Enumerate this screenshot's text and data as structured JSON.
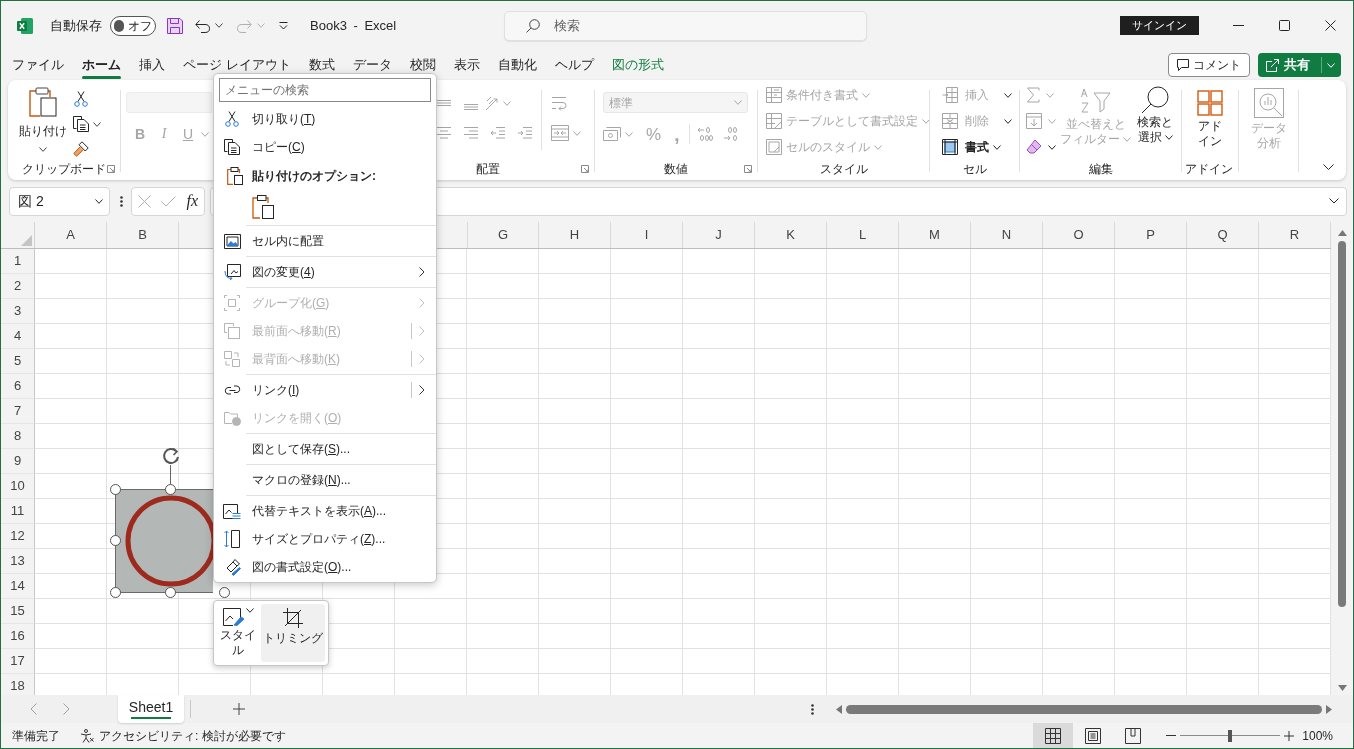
{
  "title_bar": {
    "autosave_label": "自動保存",
    "autosave_toggle": {
      "label": "オフ",
      "on": false
    },
    "redo": {
      "disabled": true
    },
    "title": "Book3 - Excel",
    "search": {
      "placeholder": "検索"
    },
    "sign_in": "サインイン"
  },
  "tabs": [
    {
      "label": "ファイル",
      "selected": false,
      "kind": "standard"
    },
    {
      "label": "ホーム",
      "selected": true,
      "kind": "standard"
    },
    {
      "label": "挿入",
      "selected": false,
      "kind": "standard"
    },
    {
      "label": "ページ レイアウト",
      "selected": false,
      "kind": "standard"
    },
    {
      "label": "数式",
      "selected": false,
      "kind": "standard"
    },
    {
      "label": "データ",
      "selected": false,
      "kind": "standard"
    },
    {
      "label": "校閲",
      "selected": false,
      "kind": "standard"
    },
    {
      "label": "表示",
      "selected": false,
      "kind": "standard"
    },
    {
      "label": "自動化",
      "selected": false,
      "kind": "standard"
    },
    {
      "label": "ヘルプ",
      "selected": false,
      "kind": "standard"
    },
    {
      "label": "図の形式",
      "selected": false,
      "kind": "contextual"
    }
  ],
  "comment_button": "コメント",
  "share_button": "共有",
  "ribbon": {
    "clipboard": {
      "label": "クリップボード",
      "paste": "貼り付け"
    },
    "font": {
      "disabled": true,
      "buttons": [
        {
          "label": "B",
          "kind": "bold"
        },
        {
          "label": "I",
          "kind": "italic"
        },
        {
          "label": "U",
          "kind": "underline"
        }
      ]
    },
    "alignment": {
      "label": "配置",
      "disabled": true
    },
    "number": {
      "label": "数値",
      "disabled": true,
      "format": "標準",
      "symbols": [
        {
          "label": "%"
        },
        {
          "label": ","
        }
      ]
    },
    "styles": {
      "label": "スタイル",
      "items": [
        {
          "label": "条件付き書式",
          "disabled": true
        },
        {
          "label": "テーブルとして書式設定",
          "disabled": true
        },
        {
          "label": "セルのスタイル",
          "disabled": true
        }
      ]
    },
    "cells": {
      "label": "セル",
      "items": [
        {
          "label": "挿入",
          "disabled": true
        },
        {
          "label": "削除",
          "disabled": true
        },
        {
          "label": "書式",
          "disabled": false
        }
      ]
    },
    "editing": {
      "label": "編集",
      "tools": [
        {
          "disabled": true
        },
        {
          "disabled": true
        },
        {
          "disabled": false
        }
      ],
      "sort_filter": {
        "lines": [
          "並べ替えと",
          "フィルター"
        ],
        "disabled": true
      },
      "find_select": {
        "lines": [
          "検索と",
          "選択"
        ],
        "disabled": false
      }
    },
    "add_ins": {
      "label": "アドイン",
      "lines": [
        "アド",
        "イン"
      ]
    },
    "data_analysis": {
      "lines": [
        "データ",
        "分析"
      ],
      "disabled": true
    }
  },
  "formula_bar": {
    "name_box": "図 2",
    "function_button": "fx"
  },
  "columns_left": [
    "A",
    "B"
  ],
  "columns_right": [
    "G",
    "H",
    "I",
    "J",
    "K",
    "L",
    "M",
    "N",
    "O",
    "P",
    "Q",
    "R"
  ],
  "rows": [
    "1",
    "2",
    "3",
    "4",
    "5",
    "6",
    "7",
    "8",
    "9",
    "10",
    "11",
    "12",
    "13",
    "14",
    "15",
    "16",
    "17",
    "18"
  ],
  "context_menu": {
    "search": {
      "placeholder": "メニューの検索"
    },
    "items": [
      {
        "kind": "command",
        "before": "切り取り(",
        "key": "T",
        "after": ")",
        "disabled": false,
        "submenu": false,
        "split": false
      },
      {
        "kind": "command",
        "before": "コピー(",
        "key": "C",
        "after": ")",
        "disabled": false,
        "submenu": false,
        "split": false
      },
      {
        "kind": "heading",
        "label": "貼り付けのオプション:"
      },
      {
        "kind": "paste_options"
      },
      {
        "kind": "separator"
      },
      {
        "kind": "command",
        "before": "セル内に配置",
        "disabled": false,
        "submenu": false,
        "split": false
      },
      {
        "kind": "separator"
      },
      {
        "kind": "command",
        "before": "図の変更(",
        "key": "4",
        "after": ")",
        "disabled": false,
        "submenu": true,
        "split": false
      },
      {
        "kind": "separator"
      },
      {
        "kind": "command",
        "before": "グループ化(",
        "key": "G",
        "after": ")",
        "disabled": true,
        "submenu": true,
        "split": false
      },
      {
        "kind": "command",
        "before": "最前面へ移動(",
        "key": "R",
        "after": ")",
        "disabled": true,
        "submenu": true,
        "split": true
      },
      {
        "kind": "command",
        "before": "最背面へ移動(",
        "key": "K",
        "after": ")",
        "disabled": true,
        "submenu": true,
        "split": true
      },
      {
        "kind": "separator"
      },
      {
        "kind": "command",
        "before": "リンク(",
        "key": "I",
        "after": ")",
        "disabled": false,
        "submenu": true,
        "split": true
      },
      {
        "kind": "command",
        "before": "リンクを開く(",
        "key": "O",
        "after": ")",
        "disabled": true,
        "submenu": false,
        "split": false
      },
      {
        "kind": "separator"
      },
      {
        "kind": "command",
        "before": "図として保存(",
        "key": "S",
        "after": ")...",
        "disabled": false,
        "submenu": false,
        "split": false
      },
      {
        "kind": "separator"
      },
      {
        "kind": "command",
        "before": "マクロの登録(",
        "key": "N",
        "after": ")...",
        "disabled": false,
        "submenu": false,
        "split": false
      },
      {
        "kind": "separator"
      },
      {
        "kind": "command",
        "before": "代替テキストを表示(",
        "key": "A",
        "after": ")...",
        "disabled": false,
        "submenu": false,
        "split": false
      },
      {
        "kind": "command",
        "before": "サイズとプロパティ(",
        "key": "Z",
        "after": ")...",
        "disabled": false,
        "submenu": false,
        "split": false
      },
      {
        "kind": "command",
        "before": "図の書式設定(",
        "key": "O",
        "after": ")...",
        "disabled": false,
        "submenu": false,
        "split": false
      }
    ]
  },
  "mini_toolbar": [
    {
      "label": "スタイル",
      "kind": "style",
      "hovered": false
    },
    {
      "label": "トリミング",
      "kind": "crop",
      "hovered": true
    }
  ],
  "sheet_tabs": [
    {
      "label": "Sheet1",
      "selected": true
    }
  ],
  "status_bar": {
    "ready": "準備完了",
    "accessibility": "アクセシビリティ: 検討が必要です",
    "views": [
      {
        "selected": true
      },
      {
        "selected": false
      },
      {
        "selected": false
      }
    ],
    "zoom": {
      "level": 0.5,
      "reading": "100%"
    }
  }
}
